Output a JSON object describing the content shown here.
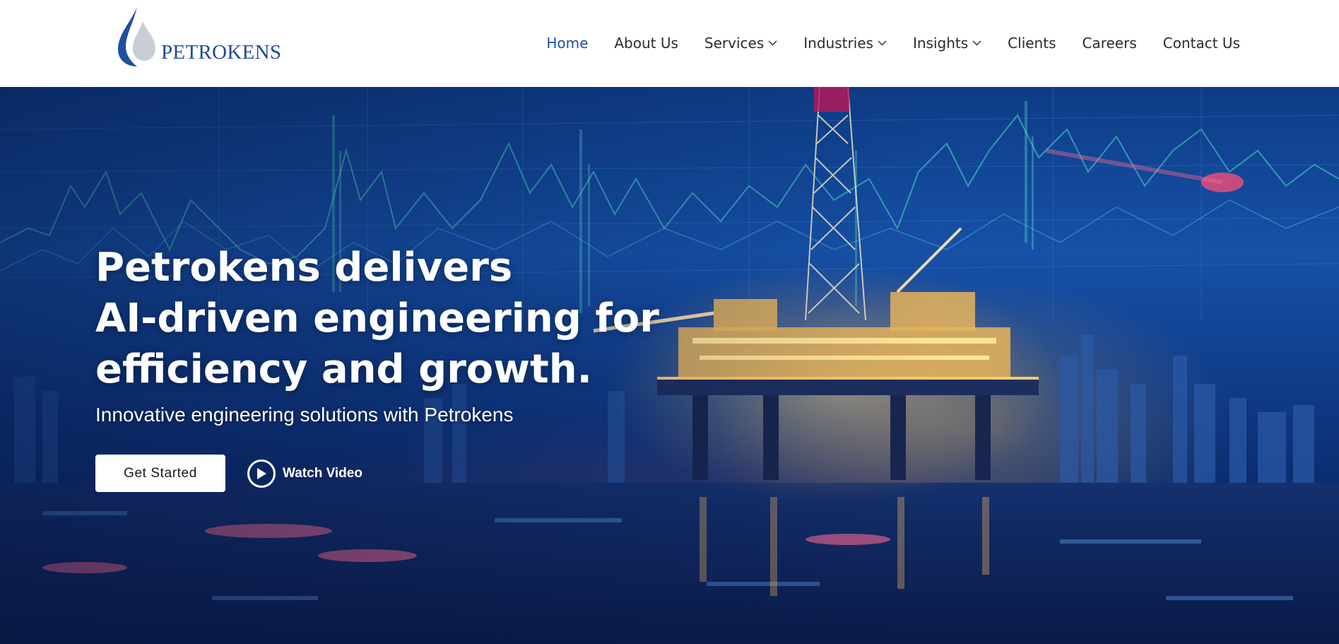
{
  "brand": {
    "name": "PETROKENS",
    "logo_icon": "oil-drop-logo-icon",
    "primary_color": "#1f4e9c",
    "accent_drop_color": "#c9ced6"
  },
  "nav": {
    "items": [
      {
        "label": "Home",
        "active": true,
        "dropdown": false
      },
      {
        "label": "About Us",
        "active": false,
        "dropdown": false
      },
      {
        "label": "Services",
        "active": false,
        "dropdown": true
      },
      {
        "label": "Industries",
        "active": false,
        "dropdown": true
      },
      {
        "label": "Insights",
        "active": false,
        "dropdown": true
      },
      {
        "label": "Clients",
        "active": false,
        "dropdown": false
      },
      {
        "label": "Careers",
        "active": false,
        "dropdown": false
      },
      {
        "label": "Contact Us",
        "active": false,
        "dropdown": false
      }
    ]
  },
  "hero": {
    "title_lines": [
      "Petrokens delivers",
      "AI-driven engineering for",
      "efficiency and growth."
    ],
    "subtitle": "Innovative engineering solutions with Petrokens",
    "primary_button": "Get Started",
    "video_button": "Watch Video",
    "video_icon": "play-circle-icon",
    "background_image": "offshore-oil-rig-with-data-charts-night"
  }
}
